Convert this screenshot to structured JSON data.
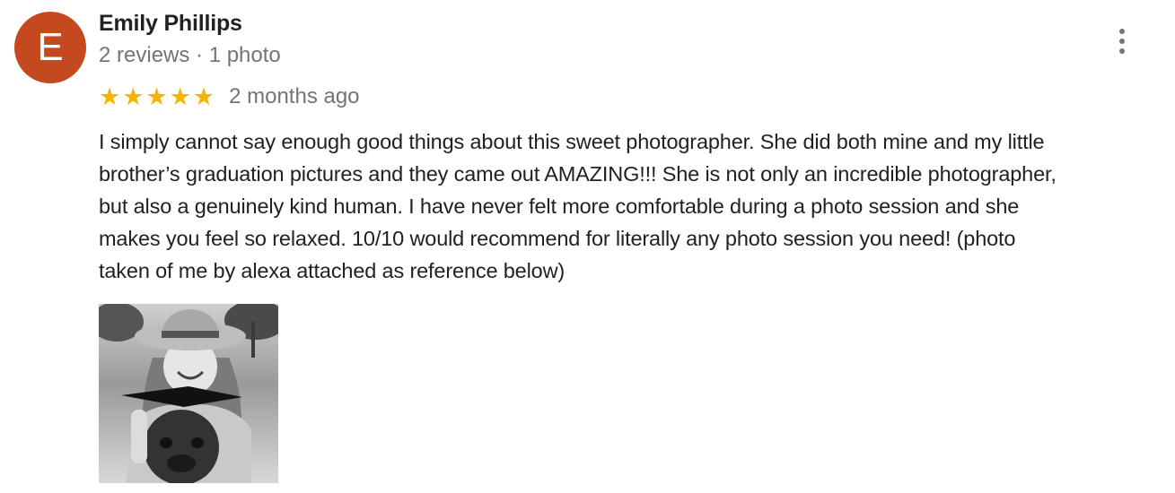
{
  "review": {
    "avatar_letter": "E",
    "avatar_color": "#c5491f",
    "reviewer_name": "Emily Phillips",
    "reviewer_meta": "2 reviews · 1 photo",
    "rating": 5,
    "rating_max": 5,
    "star_color": "#f5b400",
    "date": "2 months ago",
    "text_lines": [
      "I simply cannot say enough good things about this sweet photographer. She did both mine and my little",
      "brother’s graduation pictures and they came out AMAZING!!! She is not only an incredible photographer,",
      "but also a genuinely kind human. I have never felt more comfortable during a photo session and she",
      "makes you feel so relaxed. 10/10 would recommend for literally any photo session you need! (photo",
      "taken of me by alexa attached as reference below)"
    ],
    "more_icon": "more-vert-icon",
    "photo_icon": "review-photo"
  }
}
